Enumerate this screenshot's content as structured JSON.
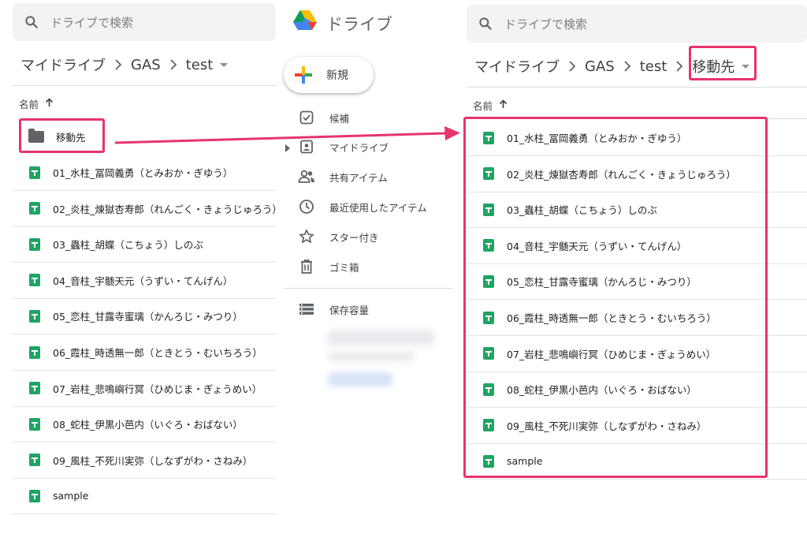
{
  "search": {
    "placeholder": "ドライブで検索"
  },
  "brand": {
    "name": "ドライブ"
  },
  "left_panel": {
    "breadcrumb": [
      "マイドライブ",
      "GAS",
      "test"
    ],
    "column_name": "名前",
    "folder": "移動先",
    "files": [
      "01_水柱_冨岡義勇（とみおか・ぎゆう）",
      "02_炎柱_煉獄杏寿郎（れんごく・きょうじゅろう）",
      "03_蟲柱_胡蝶（こちょう）しのぶ",
      "04_音柱_宇髄天元（うずい・てんげん）",
      "05_恋柱_甘露寺蜜璃（かんろじ・みつり）",
      "06_霞柱_時透無一郎（ときとう・むいちろう）",
      "07_岩柱_悲鳴嶼行冥（ひめじま・ぎょうめい）",
      "08_蛇柱_伊黒小芭内（いぐろ・おばない）",
      "09_風柱_不死川実弥（しなずがわ・さねみ）",
      "sample"
    ]
  },
  "sidebar": {
    "new_label": "新規",
    "items": [
      {
        "label": "候補",
        "icon": "check-box-icon"
      },
      {
        "label": "マイドライブ",
        "icon": "my-drive-icon"
      },
      {
        "label": "共有アイテム",
        "icon": "people-icon"
      },
      {
        "label": "最近使用したアイテム",
        "icon": "clock-icon"
      },
      {
        "label": "スター付き",
        "icon": "star-icon"
      },
      {
        "label": "ゴミ箱",
        "icon": "trash-icon"
      }
    ],
    "storage_label": "保存容量"
  },
  "right_panel": {
    "breadcrumb": [
      "マイドライブ",
      "GAS",
      "test",
      "移動先"
    ],
    "column_name": "名前",
    "files": [
      "01_水柱_冨岡義勇（とみおか・ぎゆう）",
      "02_炎柱_煉獄杏寿郎（れんごく・きょうじゅろう）",
      "03_蟲柱_胡蝶（こちょう）しのぶ",
      "04_音柱_宇髄天元（うずい・てんげん）",
      "05_恋柱_甘露寺蜜璃（かんろじ・みつり）",
      "06_霞柱_時透無一郎（ときとう・むいちろう）",
      "07_岩柱_悲鳴嶼行冥（ひめじま・ぎょうめい）",
      "08_蛇柱_伊黒小芭内（いぐろ・おばない）",
      "09_風柱_不死川実弥（しなずがわ・さねみ）",
      "sample"
    ]
  },
  "colors": {
    "accent": "#e8336d",
    "sheet_green": "#1fa463"
  }
}
